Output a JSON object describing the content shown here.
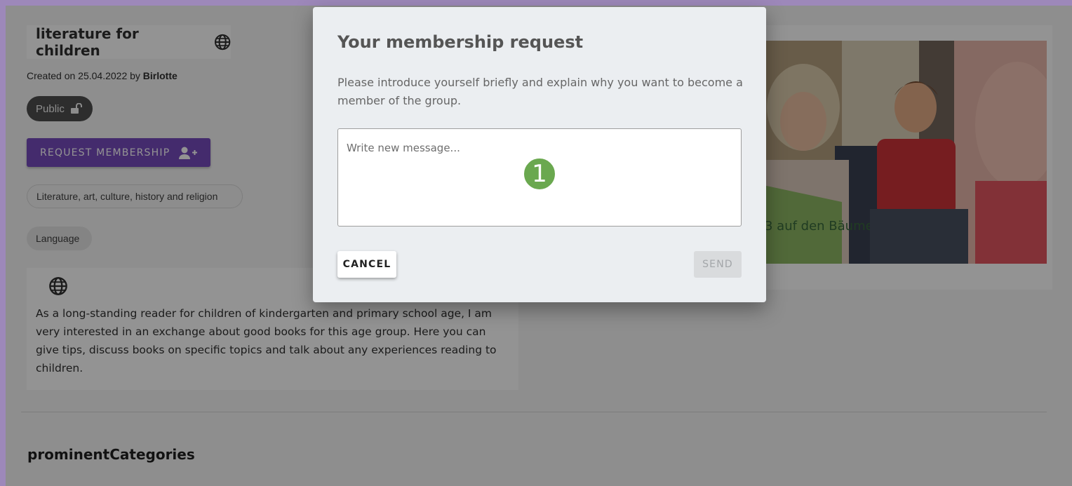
{
  "group": {
    "title": "literature for children",
    "created_prefix": "Created on 25.04.2022 by",
    "creator": "Birlotte",
    "visibility": "Public",
    "request_button": "REQUEST MEMBERSHIP",
    "category": "Literature, art, culture, history and religion",
    "language_chip": "Language",
    "description": "As a long-standing reader for children of kindergarten and primary school age, I am very interested in an exchange about good books for this age group. Here you can give tips, discuss books on specific topics and talk about any experiences reading to children.",
    "book_title_on_cover": "3 auf den Bäumen"
  },
  "section": {
    "heading": "prominentCategories"
  },
  "dialog": {
    "title": "Your membership request",
    "text": "Please introduce yourself briefly and explain why you want to become a member of the group.",
    "placeholder": "Write new message...",
    "marker": "1",
    "cancel": "CANCEL",
    "send": "SEND"
  },
  "icons": {
    "title_icon": "globe-icon",
    "visibility_icon": "unlock-icon",
    "request_icon": "add-person-icon",
    "description_icon": "globe-icon"
  },
  "colors": {
    "primary": "#6d3fba",
    "marker": "#6aa84f",
    "frame": "#9d88ba"
  }
}
